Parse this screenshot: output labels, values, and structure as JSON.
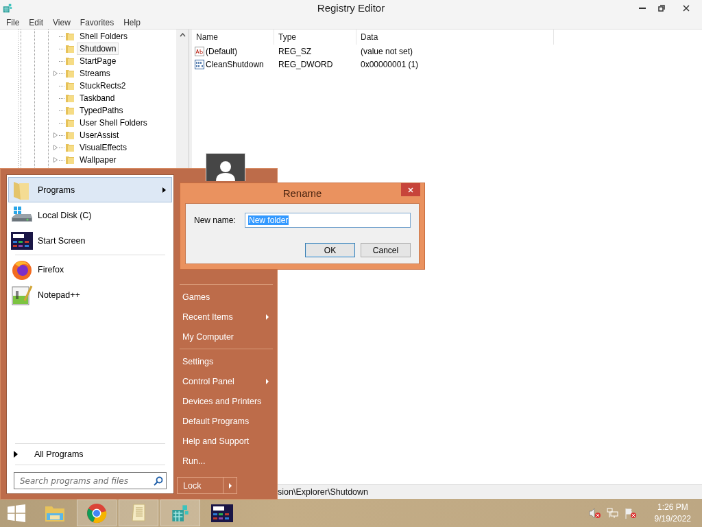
{
  "window": {
    "title": "Registry Editor"
  },
  "menu": [
    "File",
    "Edit",
    "View",
    "Favorites",
    "Help"
  ],
  "tree": {
    "items": [
      {
        "label": "Shell Folders",
        "expandable": false,
        "selected": false
      },
      {
        "label": "Shutdown",
        "expandable": false,
        "selected": true
      },
      {
        "label": "StartPage",
        "expandable": false,
        "selected": false
      },
      {
        "label": "Streams",
        "expandable": true,
        "selected": false
      },
      {
        "label": "StuckRects2",
        "expandable": false,
        "selected": false
      },
      {
        "label": "Taskband",
        "expandable": false,
        "selected": false
      },
      {
        "label": "TypedPaths",
        "expandable": false,
        "selected": false
      },
      {
        "label": "User Shell Folders",
        "expandable": false,
        "selected": false
      },
      {
        "label": "UserAssist",
        "expandable": true,
        "selected": false
      },
      {
        "label": "VisualEffects",
        "expandable": true,
        "selected": false
      },
      {
        "label": "Wallpaper",
        "expandable": true,
        "selected": false
      }
    ]
  },
  "values": {
    "columns": [
      "Name",
      "Type",
      "Data"
    ],
    "rows": [
      {
        "kind": "string",
        "name": "(Default)",
        "type": "REG_SZ",
        "data": "(value not set)"
      },
      {
        "kind": "binary",
        "name": "CleanShutdown",
        "type": "REG_DWORD",
        "data": "0x00000001 (1)"
      }
    ]
  },
  "status_bar": {
    "path": "sion\\Explorer\\Shutdown"
  },
  "start_menu": {
    "pinned": [
      {
        "kind": "folder",
        "label": "Programs",
        "submenu": true,
        "selected": true
      },
      {
        "kind": "disk",
        "label": "Local Disk (C)",
        "submenu": false,
        "selected": false
      },
      {
        "kind": "startscreen",
        "label": "Start Screen",
        "submenu": false,
        "selected": false
      }
    ],
    "recent": [
      {
        "kind": "firefox",
        "label": "Firefox",
        "submenu": false,
        "selected": false
      },
      {
        "kind": "notepad",
        "label": "Notepad++",
        "submenu": false,
        "selected": false
      }
    ],
    "all_programs": "All Programs",
    "search": {
      "placeholder": "Search programs and files"
    },
    "right_groups": [
      [
        {
          "label": "Games",
          "submenu": false
        },
        {
          "label": "Recent Items",
          "submenu": true
        },
        {
          "label": "My Computer",
          "submenu": false
        }
      ],
      [
        {
          "label": "Settings",
          "submenu": false
        },
        {
          "label": "Control Panel",
          "submenu": true
        },
        {
          "label": "Devices and Printers",
          "submenu": false
        },
        {
          "label": "Default Programs",
          "submenu": false
        },
        {
          "label": "Help and Support",
          "submenu": false
        },
        {
          "label": "Run...",
          "submenu": false
        }
      ]
    ],
    "power": {
      "label": "Lock"
    }
  },
  "dialog": {
    "title": "Rename",
    "field_label": "New name:",
    "value": "New folder",
    "buttons": [
      {
        "label": "OK",
        "default": true
      },
      {
        "label": "Cancel",
        "default": false
      }
    ]
  },
  "taskbar": {
    "apps": [
      {
        "kind": "explorer",
        "active": false
      },
      {
        "kind": "chrome",
        "active": true
      },
      {
        "kind": "notepad",
        "active": true
      },
      {
        "kind": "regedit",
        "active": true
      },
      {
        "kind": "startscreen",
        "active": false
      }
    ],
    "clock": {
      "time": "1:26 PM",
      "date": "9/19/2022"
    }
  }
}
